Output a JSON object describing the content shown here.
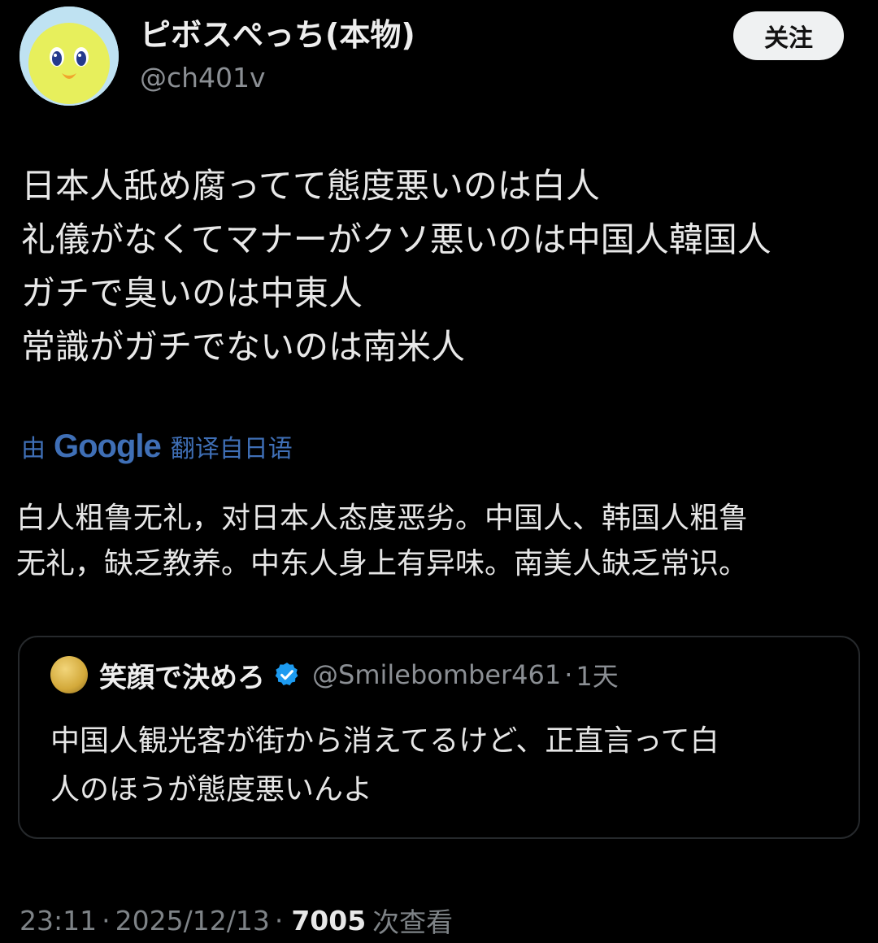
{
  "post": {
    "author": {
      "display_name": "ピボスぺっち(本物)",
      "handle": "@ch401v",
      "avatar_icon": "yellow-bird-avatar"
    },
    "follow_label": "关注",
    "text_lines": [
      "日本人舐め腐ってて態度悪いのは白人",
      "礼儀がなくてマナーがクソ悪いのは中国人韓国人",
      "ガチで臭いのは中東人",
      "常識がガチでないのは南米人"
    ],
    "translation": {
      "prefix": "由",
      "provider": "Google",
      "suffix": "翻译自日语",
      "lines": [
        "白人粗鲁无礼，对日本人态度恶劣。中国人、韩国人粗鲁",
        "无礼，缺乏教养。中东人身上有异味。南美人缺乏常识。"
      ]
    },
    "quoted": {
      "display_name": "笑顔で決めろ",
      "handle": "@Smilebomber461",
      "separator": "·",
      "time": "1天",
      "verified_icon": "verified-badge-icon",
      "text_lines": [
        "中国人観光客が街から消えてるけど、正直言って白",
        "人のほうが態度悪いんよ"
      ]
    },
    "meta": {
      "time": "23:11",
      "date": "2025/12/13",
      "separator": "·",
      "views_count": "7005",
      "views_label": "次查看"
    }
  },
  "colors": {
    "background": "#000000",
    "text_primary": "#e7e9ea",
    "text_secondary": "#8b8f94",
    "link_blue": "#3f6fb6",
    "verified_blue": "#1d9bf0",
    "card_border": "#26292c"
  }
}
